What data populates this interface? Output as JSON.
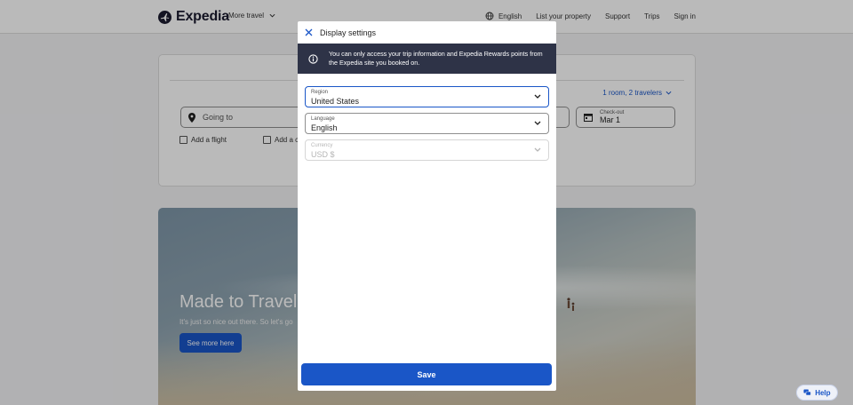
{
  "header": {
    "brand": "Expedia",
    "more_travel": "More travel",
    "nav": [
      "English",
      "List your property",
      "Support",
      "Trips",
      "Sign in"
    ]
  },
  "search": {
    "travelers": "1 room, 2 travelers",
    "going_to_placeholder": "Going to",
    "checkout_label": "Check-out",
    "checkout_value": "Mar 1",
    "add_flight": "Add a flight",
    "add_car": "Add a ca"
  },
  "hero": {
    "title": "Made to Travel",
    "subtitle": "It's just so nice out there. So let's go",
    "button": "See more here"
  },
  "modal": {
    "title": "Display settings",
    "info": "You can only access your trip information and Expedia Rewards points from the Expedia site you booked on.",
    "region": {
      "label": "Region",
      "value": "United States"
    },
    "language": {
      "label": "Language",
      "value": "English"
    },
    "currency": {
      "label": "Currency",
      "value": "USD $"
    },
    "save": "Save"
  },
  "help": "Help",
  "colors": {
    "accent": "#1a56c7",
    "banner": "#2e3347"
  }
}
